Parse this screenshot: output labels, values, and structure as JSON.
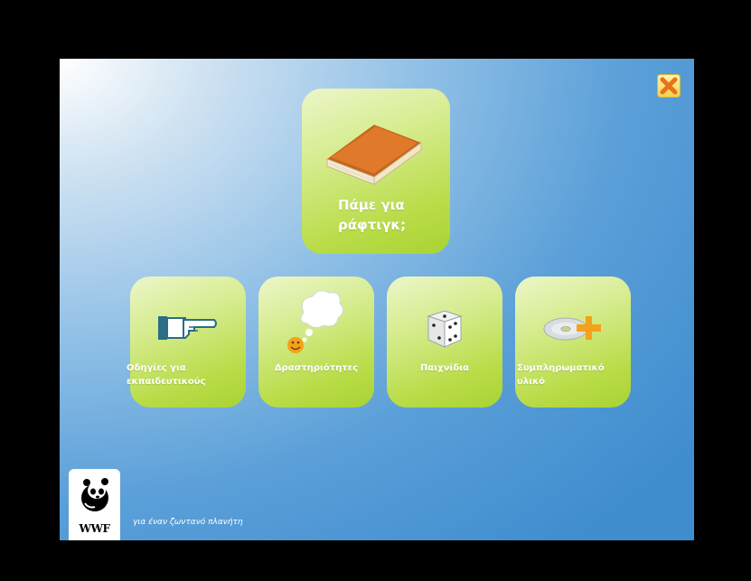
{
  "window": {
    "close_label": "Close"
  },
  "main_tile": {
    "label_line1": "Πάμε για",
    "label_line2": "ράφτιγκ;",
    "icon": "book-icon"
  },
  "tiles": [
    {
      "label_line1": "Οδηγίες για",
      "label_line2": "εκπαιδευτικούς",
      "icon": "pointing-hand-icon"
    },
    {
      "label_line1": "Δραστηριότητες",
      "label_line2": "",
      "icon": "thought-bubble-smiley-icon"
    },
    {
      "label_line1": "Παιχνίδια",
      "label_line2": "",
      "icon": "dice-icon"
    },
    {
      "label_line1": "Συμπληρωματικό",
      "label_line2": "υλικό",
      "icon": "cd-plus-icon"
    }
  ],
  "branding": {
    "logo_text": "WWF",
    "tagline": "για έναν ζωντανό πλανήτη"
  },
  "colors": {
    "tile_green": "#b9dc48",
    "background_blue": "#4a93d2",
    "close_orange": "#e8731a",
    "close_yellow": "#f3d24a"
  }
}
